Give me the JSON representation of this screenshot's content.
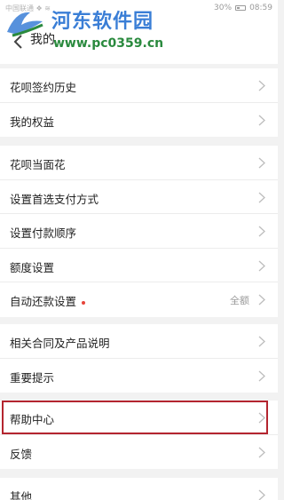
{
  "status": {
    "carrier": "中国联通 ❖ ≋",
    "battery": "30%",
    "time": "08:59"
  },
  "nav": {
    "title": "我的"
  },
  "watermark": {
    "title": "河东软件园",
    "url": "www.pc0359.cn"
  },
  "groups": [
    {
      "items": [
        {
          "label": "花呗签约历史"
        },
        {
          "label": "我的权益"
        }
      ]
    },
    {
      "items": [
        {
          "label": "花呗当面花"
        },
        {
          "label": "设置首选支付方式"
        },
        {
          "label": "设置付款顺序"
        },
        {
          "label": "额度设置"
        },
        {
          "label": "自动还款设置",
          "value": "全额"
        }
      ]
    },
    {
      "items": [
        {
          "label": "相关合同及产品说明"
        },
        {
          "label": "重要提示"
        }
      ]
    },
    {
      "items": [
        {
          "label": "帮助中心"
        },
        {
          "label": "反馈"
        }
      ]
    },
    {
      "items": [
        {
          "label": "其他"
        }
      ]
    }
  ],
  "colors": {
    "highlight": "#b4252f",
    "dot": "#e6443a"
  }
}
